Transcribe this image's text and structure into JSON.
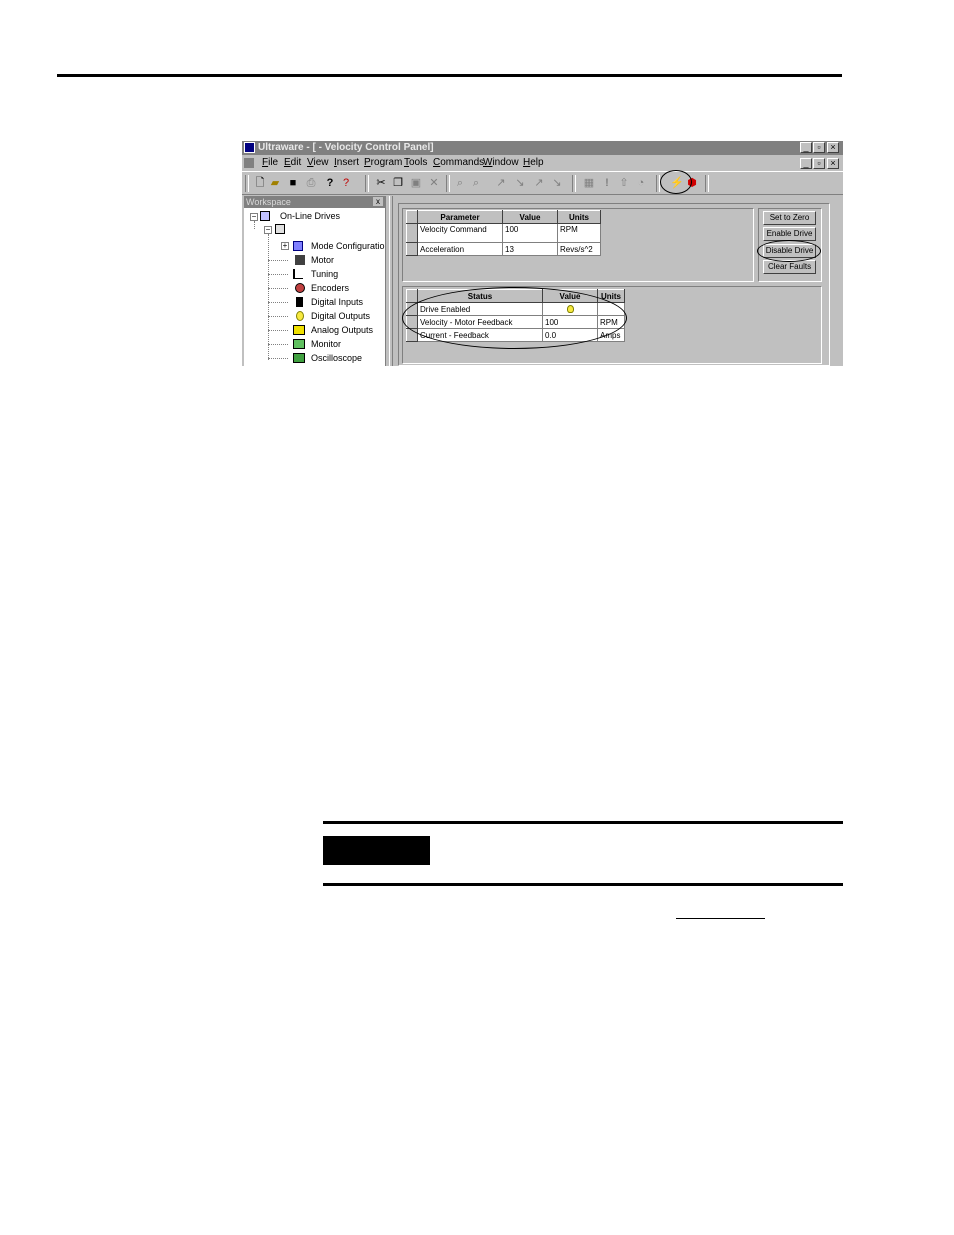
{
  "window": {
    "title": "Ultraware - [ - Velocity Control Panel]",
    "colors": {
      "titlebar": "#808080",
      "face": "#c0c0c0",
      "highlight_bulb": "#f7e940"
    }
  },
  "menu": {
    "items": [
      {
        "key": "F",
        "rest": "ile"
      },
      {
        "key": "E",
        "rest": "dit"
      },
      {
        "key": "V",
        "rest": "iew"
      },
      {
        "key": "I",
        "rest": "nsert"
      },
      {
        "key": "P",
        "rest": "rogram"
      },
      {
        "key": "T",
        "rest": "ools"
      },
      {
        "key": "C",
        "rest": "ommands"
      },
      {
        "key": "W",
        "rest": "indow"
      },
      {
        "key": "H",
        "rest": "elp"
      }
    ]
  },
  "toolbar": {
    "icons": [
      "new-file-icon",
      "open-folder-icon",
      "save-icon",
      "print-icon",
      "help-icon",
      "context-help-icon",
      "cut-icon",
      "copy-icon",
      "paste-icon",
      "delete-icon",
      "find-icon",
      "find-replace-icon",
      "connect-icon",
      "disconnect-icon",
      "upload-icon",
      "download-icon",
      "compile-icon",
      "alert-icon",
      "upload-drive-icon",
      "info-icon",
      "velocity-panel-icon",
      "stop-icon"
    ]
  },
  "workspace": {
    "title": "Workspace",
    "close": "x",
    "root": "On-Line Drives",
    "drive_label": "",
    "items": [
      {
        "label": "Mode Configuratio",
        "icon": "mode-config-icon",
        "expand": "+"
      },
      {
        "label": "Motor",
        "icon": "motor-icon"
      },
      {
        "label": "Tuning",
        "icon": "tuning-icon"
      },
      {
        "label": "Encoders",
        "icon": "encoder-icon"
      },
      {
        "label": "Digital Inputs",
        "icon": "digital-input-icon"
      },
      {
        "label": "Digital Outputs",
        "icon": "digital-output-icon"
      },
      {
        "label": "Analog Outputs",
        "icon": "analog-output-icon"
      },
      {
        "label": "Monitor",
        "icon": "monitor-icon"
      },
      {
        "label": "Oscilloscope",
        "icon": "oscilloscope-icon"
      }
    ]
  },
  "parameters": {
    "headers": [
      "Parameter",
      "Value",
      "Units"
    ],
    "rows": [
      [
        "Velocity Command",
        "100",
        "RPM"
      ],
      [
        "Acceleration",
        "13",
        "Revs/s^2"
      ]
    ]
  },
  "buttons": {
    "set_to_zero": "Set to Zero",
    "enable_drive": "Enable Drive",
    "disable_drive": "Disable Drive",
    "clear_faults": "Clear Faults"
  },
  "status": {
    "headers": [
      "Status",
      "Value",
      "Units"
    ],
    "rows": [
      [
        "Drive Enabled",
        "",
        ""
      ],
      [
        "Velocity - Motor Feedback",
        "100",
        "RPM"
      ],
      [
        "Current - Feedback",
        "0.0",
        "Amps"
      ]
    ]
  }
}
